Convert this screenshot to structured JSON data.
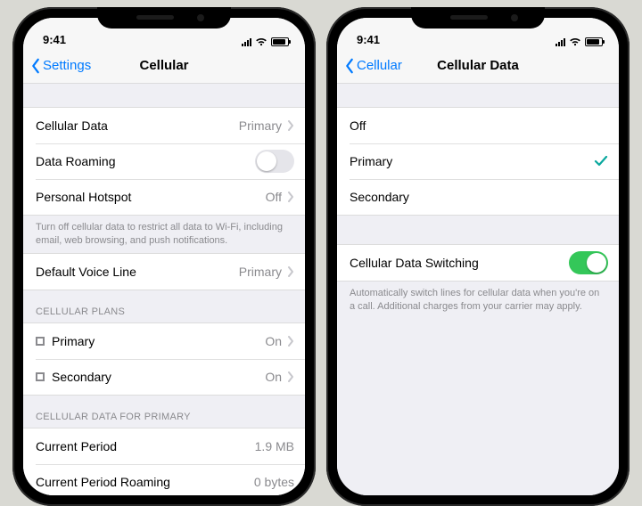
{
  "status": {
    "time": "9:41"
  },
  "left": {
    "back_label": "Settings",
    "title": "Cellular",
    "cellular_data": {
      "label": "Cellular Data",
      "value": "Primary"
    },
    "data_roaming": {
      "label": "Data Roaming",
      "on": false
    },
    "personal_hotspot": {
      "label": "Personal Hotspot",
      "value": "Off"
    },
    "hotspot_footer": "Turn off cellular data to restrict all data to Wi-Fi, including email, web browsing, and push notifications.",
    "default_voice": {
      "label": "Default Voice Line",
      "value": "Primary"
    },
    "plans_header": "CELLULAR PLANS",
    "plans": [
      {
        "label": "Primary",
        "value": "On"
      },
      {
        "label": "Secondary",
        "value": "On"
      }
    ],
    "data_for_header": "CELLULAR DATA FOR PRIMARY",
    "current_period": {
      "label": "Current Period",
      "value": "1.9 MB"
    },
    "current_roaming": {
      "label": "Current Period Roaming",
      "value": "0 bytes"
    }
  },
  "right": {
    "back_label": "Cellular",
    "title": "Cellular Data",
    "options": [
      {
        "label": "Off",
        "selected": false
      },
      {
        "label": "Primary",
        "selected": true
      },
      {
        "label": "Secondary",
        "selected": false
      }
    ],
    "switching": {
      "label": "Cellular Data Switching",
      "on": true
    },
    "switching_footer": "Automatically switch lines for cellular data when you're on a call. Additional charges from your carrier may apply."
  }
}
